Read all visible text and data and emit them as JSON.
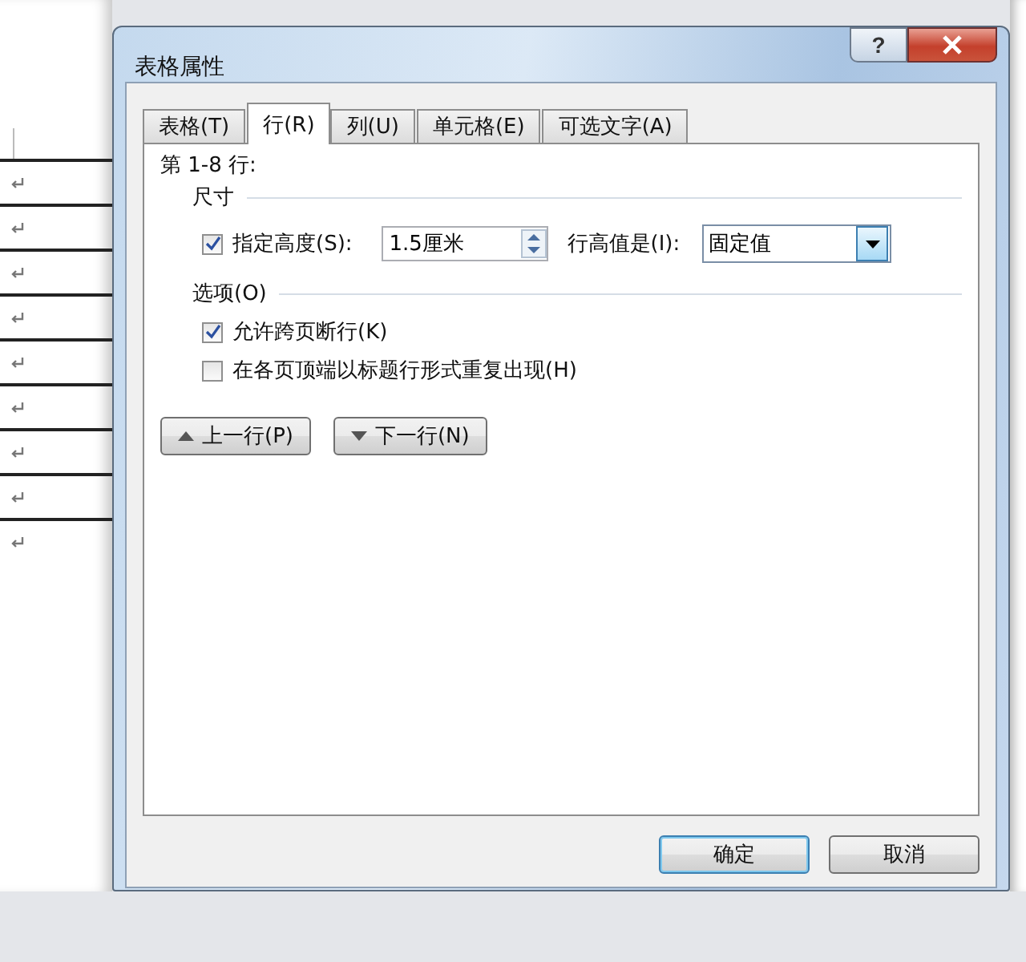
{
  "dialog": {
    "title": "表格属性",
    "help": "?",
    "tabs": [
      {
        "label": "表格(T)",
        "selected": false
      },
      {
        "label": "行(R)",
        "selected": true
      },
      {
        "label": "列(U)",
        "selected": false
      },
      {
        "label": "单元格(E)",
        "selected": false
      },
      {
        "label": "可选文字(A)",
        "selected": false
      }
    ],
    "row_range": "第 1-8 行:",
    "size_section": {
      "title": "尺寸",
      "specify_height": {
        "label": "指定高度(S):",
        "checked": true
      },
      "height_value": "1.5厘米",
      "mode_label": "行高值是(I):",
      "mode_value": "固定值"
    },
    "options_section": {
      "title": "选项(O)",
      "options": [
        {
          "label": "允许跨页断行(K)",
          "checked": true
        },
        {
          "label": "在各页顶端以标题行形式重复出现(H)",
          "checked": false
        }
      ]
    },
    "nav_buttons": [
      {
        "label": "上一行(P)",
        "kind": "up"
      },
      {
        "label": "下一行(N)",
        "kind": "down"
      }
    ],
    "footer_buttons": [
      {
        "label": "确定",
        "default": true
      },
      {
        "label": "取消",
        "default": false
      }
    ]
  }
}
